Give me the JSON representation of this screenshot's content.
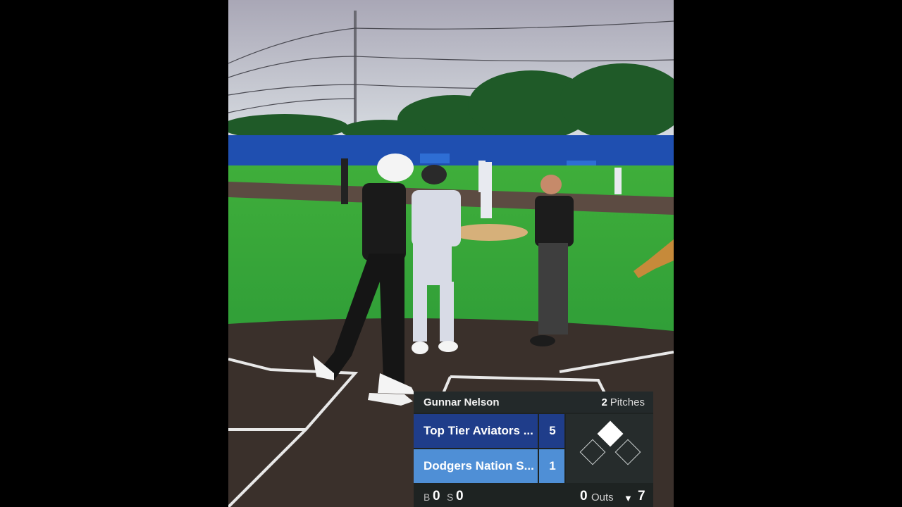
{
  "scoreboard": {
    "batter_name": "Gunnar Nelson",
    "pitch_count": "2",
    "pitch_label": "Pitches",
    "away_team": {
      "name": "Top Tier Aviators ...",
      "score": "5",
      "color": "#1f3d8a"
    },
    "home_team": {
      "name": "Dodgers Nation S...",
      "score": "1",
      "color": "#4f8fd6"
    },
    "bases": {
      "first": false,
      "second": true,
      "third": false
    },
    "count": {
      "balls_label": "B",
      "balls": "0",
      "strikes_label": "S",
      "strikes": "0"
    },
    "outs": "0",
    "outs_label": "Outs",
    "inning_half_icon": "triangle-down-icon",
    "inning": "7"
  }
}
